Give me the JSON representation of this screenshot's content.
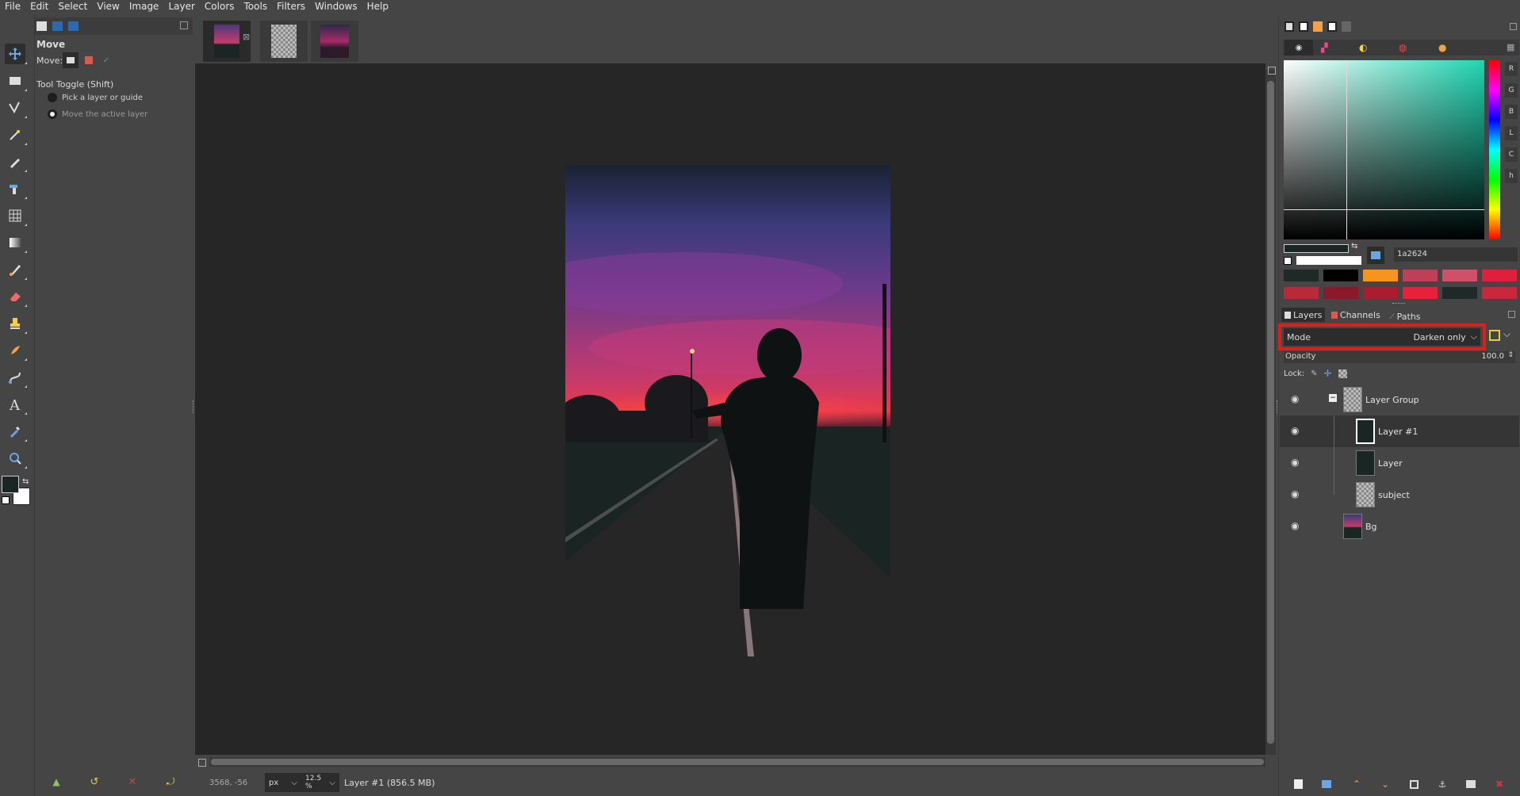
{
  "menubar": {
    "items": [
      "File",
      "Edit",
      "Select",
      "View",
      "Image",
      "Layer",
      "Colors",
      "Tools",
      "Filters",
      "Windows",
      "Help"
    ]
  },
  "tool_options": {
    "title": "Move",
    "move_label": "Move:",
    "toggle_label": "Tool Toggle  (Shift)",
    "options": [
      "Pick a layer or guide",
      "Move the active layer"
    ],
    "selected_option": 1
  },
  "colors": {
    "fg": "#1a2624",
    "bg": "#ffffff",
    "hex_value": "1a2624",
    "channel_buttons": [
      "R",
      "G",
      "B",
      "L",
      "C",
      "h"
    ],
    "history_swatches": [
      "#1f2a28",
      "#000000",
      "#f7941d",
      "#c0405a",
      "#d0506a",
      "#e0203a",
      "#b82a3a",
      "#8a1a2a",
      "#a81e2e",
      "#e8203a",
      "#1f2a28",
      "#c8283a"
    ]
  },
  "layers_panel": {
    "tabs": [
      "Layers",
      "Channels",
      "Paths"
    ],
    "mode_label": "Mode",
    "mode_value": "Darken only",
    "opacity_label": "Opacity",
    "opacity_value": "100.0",
    "lock_label": "Lock:",
    "layers": [
      {
        "name": "Layer Group",
        "indent": 0,
        "type": "group",
        "selected": false
      },
      {
        "name": "Layer #1",
        "indent": 1,
        "type": "white",
        "selected": true
      },
      {
        "name": "Layer",
        "indent": 1,
        "type": "dark",
        "selected": false
      },
      {
        "name": "subject",
        "indent": 1,
        "type": "checker",
        "selected": false
      },
      {
        "name": "Bg",
        "indent": 0,
        "type": "photo",
        "selected": false
      }
    ]
  },
  "statusbar": {
    "coords": "3568, -56",
    "unit": "px",
    "zoom": "12.5 %",
    "layer_info": "Layer #1 (856.5 MB)"
  },
  "accent": {
    "highlight_box": "#d9211b",
    "selection_blue": "#3e7fc4"
  }
}
